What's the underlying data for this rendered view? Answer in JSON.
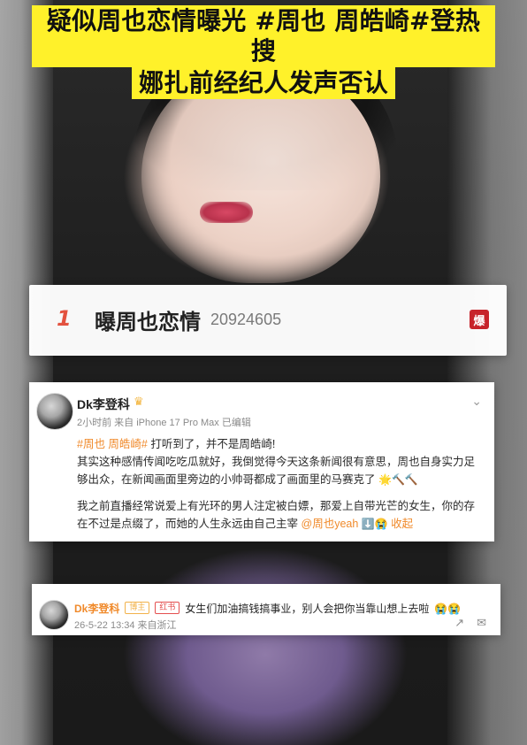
{
  "title": {
    "line1": "疑似周也恋情曝光 #周也 周皓崎#登热搜",
    "line2": "娜扎前经纪人发声否认"
  },
  "trend": {
    "rank": "1",
    "topic": "曝周也恋情",
    "heat": "20924605",
    "badge": "爆"
  },
  "post": {
    "author": "Dk李登科",
    "meta": "2小时前  来自 iPhone 17 Pro Max 已编辑",
    "hashtag_text": "#周也 周皓崎#",
    "p1_rest": " 打听到了，并不是周皓崎!",
    "p2": "其实这种感情传闻吃吃瓜就好，我倒觉得今天这条新闻很有意思，周也自身实力足够出众，在新闻画面里旁边的小帅哥都成了画面里的马赛克了",
    "p3_start": "我之前直播经常说爱上有光环的男人注定被白嫖，那爱上自带光芒的女生，你的存在不过是点缀了，而她的人生永远由自己主宰",
    "mention": "@周也yeah",
    "collapse": "收起",
    "emoji": {
      "p2_end": "🌟🔨🔨",
      "p3_end": "⬇️😭"
    },
    "icons": {
      "crown": "crown-icon",
      "dropdown": "chevron-down-icon"
    }
  },
  "comment": {
    "author": "Dk李登科",
    "tag1": "博主",
    "tag2": "红书",
    "text": "女生们加油搞钱搞事业，别人会把你当靠山想上去啦",
    "emoji": "😭😭",
    "meta": "26-5-22 13:34  来自浙江",
    "icons": {
      "share": "share-icon",
      "reply": "comment-icon"
    }
  }
}
